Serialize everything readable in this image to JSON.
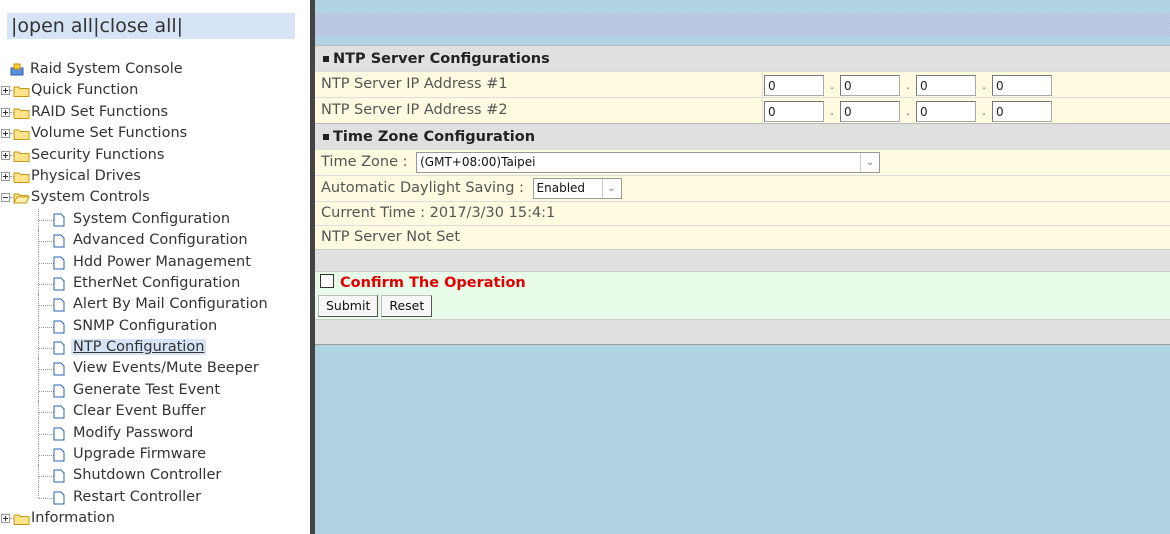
{
  "sidebar": {
    "open_all": "open all",
    "close_all": "close all",
    "root_label": "Raid System Console",
    "items": [
      {
        "label": "Quick Function"
      },
      {
        "label": "RAID Set Functions"
      },
      {
        "label": "Volume Set Functions"
      },
      {
        "label": "Security Functions"
      },
      {
        "label": "Physical Drives"
      },
      {
        "label": "System Controls"
      },
      {
        "label": "Information"
      }
    ],
    "system_controls_children": [
      {
        "label": "System Configuration"
      },
      {
        "label": "Advanced Configuration"
      },
      {
        "label": "Hdd Power Management"
      },
      {
        "label": "EtherNet Configuration"
      },
      {
        "label": "Alert By Mail Configuration"
      },
      {
        "label": "SNMP Configuration"
      },
      {
        "label": "NTP Configuration"
      },
      {
        "label": "View Events/Mute Beeper"
      },
      {
        "label": "Generate Test Event"
      },
      {
        "label": "Clear Event Buffer"
      },
      {
        "label": "Modify Password"
      },
      {
        "label": "Upgrade Firmware"
      },
      {
        "label": "Shutdown Controller"
      },
      {
        "label": "Restart Controller"
      }
    ],
    "selected": "NTP Configuration"
  },
  "main": {
    "ntp_section_title": "NTP Server Configurations",
    "ntp1_label": "NTP Server IP Address #1",
    "ntp1_octets": [
      "0",
      "0",
      "0",
      "0"
    ],
    "ntp2_label": "NTP Server IP Address #2",
    "ntp2_octets": [
      "0",
      "0",
      "0",
      "0"
    ],
    "tz_section_title": "Time Zone Configuration",
    "tz_label": "Time Zone :",
    "tz_value": "(GMT+08:00)Taipei",
    "dst_label": "Automatic Daylight Saving :",
    "dst_value": "Enabled",
    "current_time": "Current Time : 2017/3/30 15:4:1",
    "ntp_status": "NTP Server Not Set",
    "confirm_label": "Confirm The Operation",
    "submit_label": "Submit",
    "reset_label": "Reset"
  },
  "colors": {
    "confirm_text": "#e00000",
    "background_blue": "#b0d4e2",
    "row_yellow": "#fffbe0",
    "row_green": "#e8fbe8"
  }
}
